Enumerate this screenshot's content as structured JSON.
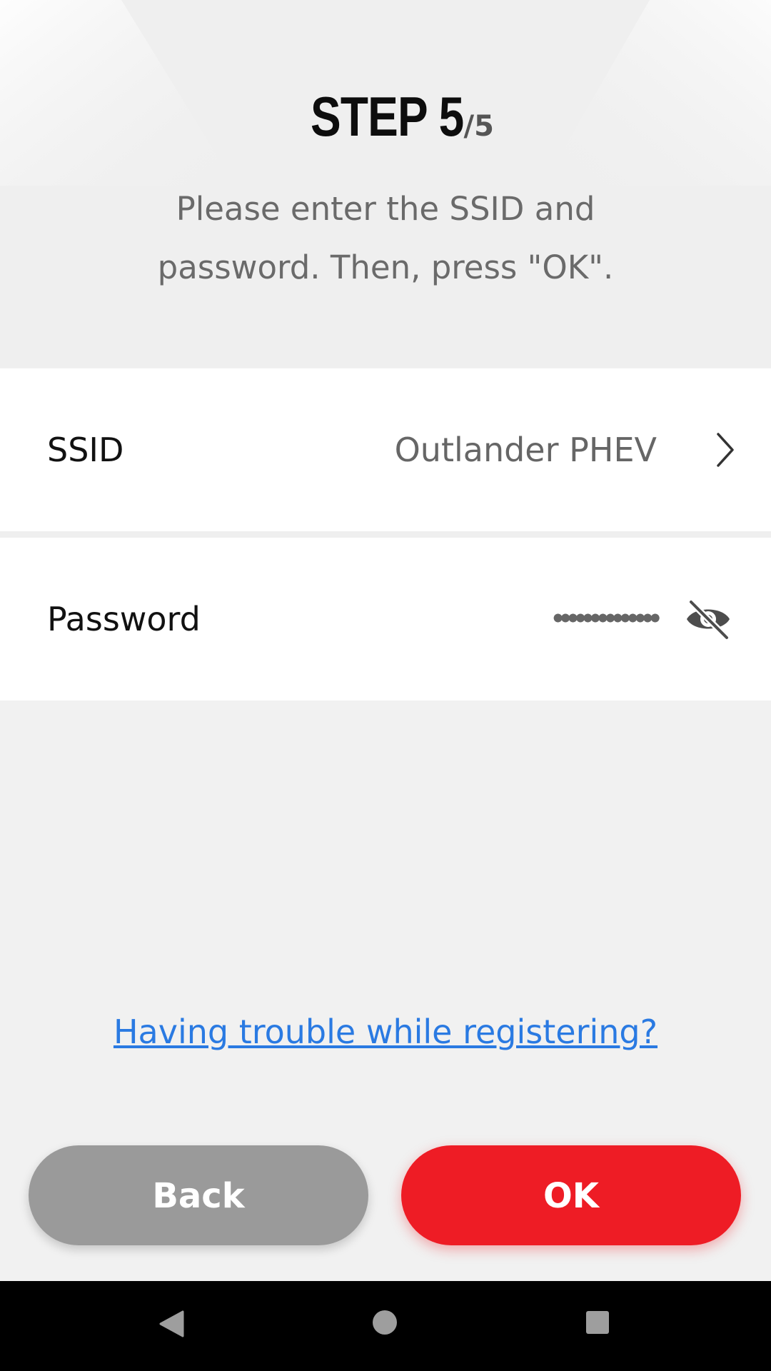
{
  "header": {
    "step_main": "STEP 5",
    "step_total": "/5",
    "instruction_line1": "Please enter the SSID and",
    "instruction_line2": "password. Then, press \"OK\"."
  },
  "form": {
    "ssid_label": "SSID",
    "ssid_value": "Outlander PHEV",
    "password_label": "Password",
    "password_masked": "••••••••••••••"
  },
  "help": {
    "link_text": "Having trouble while registering?"
  },
  "buttons": {
    "back_label": "Back",
    "ok_label": "OK"
  },
  "icons": {
    "ssid_chevron": "chevron-right-icon",
    "password_visibility": "eye-off-icon",
    "nav_back": "triangle-back-icon",
    "nav_home": "circle-home-icon",
    "nav_recents": "square-recents-icon"
  },
  "colors": {
    "accent": "#ee1c25",
    "link": "#2a7ae2",
    "back_button": "#9a9a9a",
    "background": "#f1f1f1"
  }
}
